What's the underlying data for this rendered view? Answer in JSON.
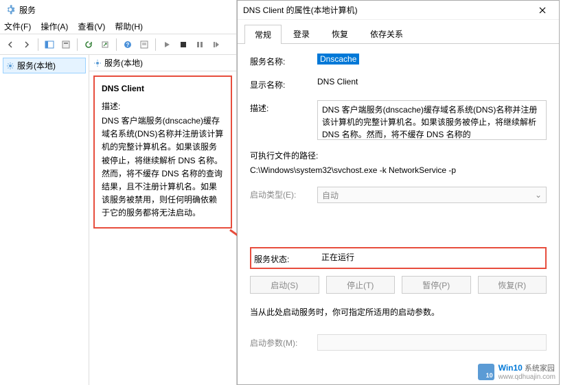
{
  "main": {
    "title": "服务",
    "menu": {
      "file": "文件(F)",
      "action": "操作(A)",
      "view": "查看(V)",
      "help": "帮助(H)"
    },
    "leftItem": "服务(本地)",
    "rightHeader": "服务(本地)",
    "detail": {
      "name": "DNS Client",
      "descLabel": "描述:",
      "desc": "DNS 客户端服务(dnscache)缓存域名系统(DNS)名称并注册该计算机的完整计算机名。如果该服务被停止，将继续解析 DNS 名称。然而，将不缓存 DNS 名称的查询结果，且不注册计算机名。如果该服务被禁用，则任何明确依赖于它的服务都将无法启动。"
    }
  },
  "dialog": {
    "title": "DNS Client 的属性(本地计算机)",
    "tabs": {
      "general": "常规",
      "logon": "登录",
      "recovery": "恢复",
      "deps": "依存关系"
    },
    "rows": {
      "serviceNameLabel": "服务名称:",
      "serviceName": "Dnscache",
      "displayNameLabel": "显示名称:",
      "displayName": "DNS Client",
      "descLabel": "描述:",
      "desc": "DNS 客户端服务(dnscache)缓存域名系统(DNS)名称并注册该计算机的完整计算机名。如果该服务被停止，将继续解析 DNS 名称。然而，将不缓存 DNS 名称的",
      "pathLabel": "可执行文件的路径:",
      "path": "C:\\Windows\\system32\\svchost.exe -k NetworkService -p",
      "startupLabel": "启动类型(E):",
      "startup": "自动",
      "statusLabel": "服务状态:",
      "status": "正在运行",
      "hint": "当从此处启动服务时，你可指定所适用的启动参数。",
      "paramLabel": "启动参数(M):"
    },
    "buttons": {
      "start": "启动(S)",
      "stop": "停止(T)",
      "pause": "暂停(P)",
      "resume": "恢复(R)"
    }
  },
  "watermark": {
    "brand": "Win10",
    "suffix": "系统家园",
    "url": "www.qdhuajin.com"
  }
}
